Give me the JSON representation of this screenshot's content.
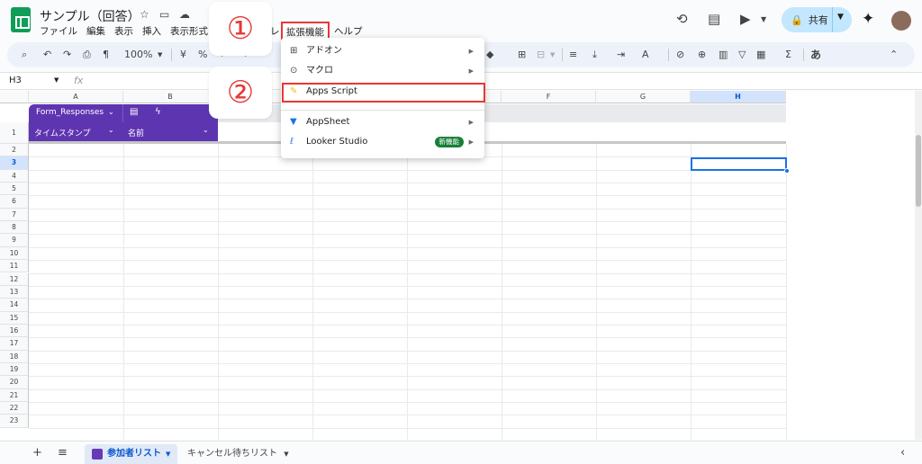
{
  "title_bar": {
    "doc_title": "サンプル（回答）",
    "menus": [
      "ファイル",
      "編集",
      "表示",
      "挿入",
      "表示形式"
    ],
    "menu_partial": "レ",
    "menu_extensions": "拡張機能",
    "menu_help": "ヘルプ",
    "share_label": "共有"
  },
  "callouts": {
    "one": "①",
    "two": "②"
  },
  "toolbar": {
    "zoom": "100%",
    "currency": "¥",
    "percent": "%",
    "input_tool": "あ"
  },
  "formula_bar": {
    "name_box": "H3",
    "fx": "fx"
  },
  "columns": [
    "A",
    "B",
    "C",
    "D",
    "E",
    "F",
    "G",
    "H"
  ],
  "rows": [
    "1",
    "2",
    "3",
    "4",
    "5",
    "6",
    "7",
    "8",
    "9",
    "10",
    "11",
    "12",
    "13",
    "14",
    "15",
    "16",
    "17",
    "18",
    "19",
    "20",
    "21",
    "22",
    "23"
  ],
  "table": {
    "name": "Form_Responses",
    "col1": "タイムスタンプ",
    "col2": "名前"
  },
  "dropdown": {
    "addons": "アドオン",
    "macros": "マクロ",
    "apps_script": "Apps Script",
    "appsheet": "AppSheet",
    "looker": "Looker Studio",
    "new_badge": "新機能"
  },
  "bottom": {
    "active_tab": "参加者リスト",
    "tab2": "キャンセル待ちリスト"
  },
  "colors": {
    "table_purple": "#5e35b1",
    "annotation_red": "#e53935",
    "selection_blue": "#1a73e8"
  }
}
